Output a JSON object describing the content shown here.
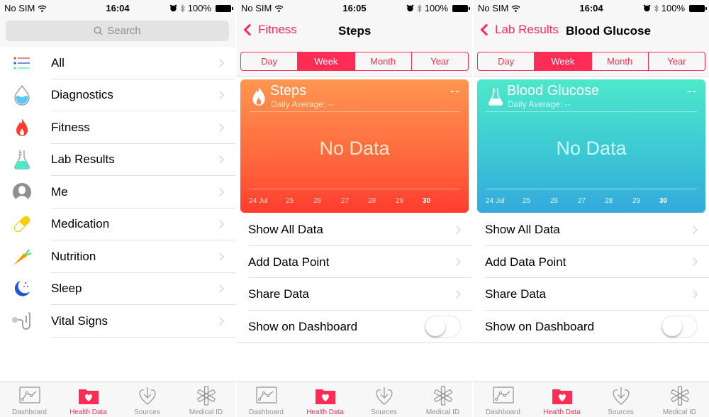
{
  "theme": {
    "accent": "#ff2d55",
    "fitness_card": "#ff6a40",
    "lab_card": "#3cc8d4"
  },
  "screens": [
    {
      "status": {
        "carrier": "No SIM",
        "time": "16:04",
        "battery": "100%"
      },
      "search": {
        "placeholder": "Search",
        "icon": "search-icon"
      },
      "categories": [
        {
          "label": "All",
          "icon": "list-icon"
        },
        {
          "label": "Diagnostics",
          "icon": "water-drop-icon"
        },
        {
          "label": "Fitness",
          "icon": "flame-icon"
        },
        {
          "label": "Lab Results",
          "icon": "flask-icon"
        },
        {
          "label": "Me",
          "icon": "person-icon"
        },
        {
          "label": "Medication",
          "icon": "pill-icon"
        },
        {
          "label": "Nutrition",
          "icon": "carrot-icon"
        },
        {
          "label": "Sleep",
          "icon": "moon-icon"
        },
        {
          "label": "Vital Signs",
          "icon": "stethoscope-icon"
        }
      ]
    },
    {
      "status": {
        "carrier": "No SIM",
        "time": "16:05",
        "battery": "100%"
      },
      "back_label": "Fitness",
      "title": "Steps",
      "segments": [
        "Day",
        "Week",
        "Month",
        "Year"
      ],
      "selected_segment": "Week",
      "card": {
        "title": "Steps",
        "subtitle": "Daily Average: --",
        "value": "--",
        "empty_text": "No Data",
        "icon": "flame-icon",
        "x_ticks": [
          "24 Jul",
          "25",
          "26",
          "27",
          "28",
          "29",
          "30"
        ],
        "current_tick": "30"
      },
      "actions": [
        "Show All Data",
        "Add Data Point",
        "Share Data"
      ],
      "toggle_label": "Show on Dashboard",
      "toggle_on": false
    },
    {
      "status": {
        "carrier": "No SIM",
        "time": "16:04",
        "battery": "100%"
      },
      "back_label": "Lab Results",
      "title": "Blood Glucose",
      "segments": [
        "Day",
        "Week",
        "Month",
        "Year"
      ],
      "selected_segment": "Week",
      "card": {
        "title": "Blood Glucose",
        "subtitle": "Daily Average: --",
        "value": "--",
        "empty_text": "No Data",
        "icon": "flask-icon",
        "x_ticks": [
          "24 Jul",
          "25",
          "26",
          "27",
          "28",
          "29",
          "30"
        ],
        "current_tick": "30"
      },
      "actions": [
        "Show All Data",
        "Add Data Point",
        "Share Data"
      ],
      "toggle_label": "Show on Dashboard",
      "toggle_on": false
    }
  ],
  "tabbar": [
    {
      "label": "Dashboard",
      "icon": "dashboard-chart-icon",
      "active": false
    },
    {
      "label": "Health Data",
      "icon": "health-folder-icon",
      "active": true
    },
    {
      "label": "Sources",
      "icon": "sources-heart-download-icon",
      "active": false
    },
    {
      "label": "Medical ID",
      "icon": "medical-asterisk-icon",
      "active": false
    }
  ]
}
